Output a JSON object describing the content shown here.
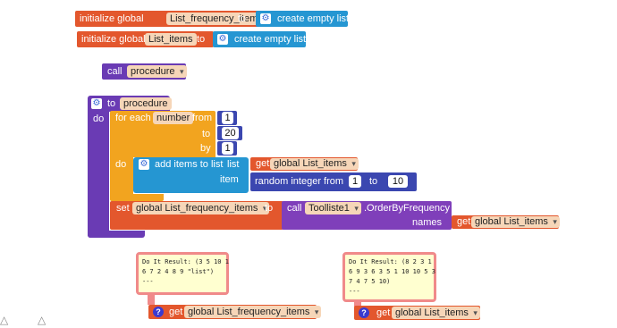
{
  "init1": {
    "label": "initialize global",
    "var": "List_frequency_items",
    "to": "to",
    "value": "create empty list"
  },
  "init2": {
    "label": "initialize global",
    "var": "List_items",
    "to": "to",
    "value": "create empty list"
  },
  "call1": {
    "label": "call",
    "proc": "procedure"
  },
  "proc": {
    "to": "to",
    "name": "procedure",
    "do": "do",
    "for": {
      "label": "for each",
      "var": "number",
      "from": "from",
      "from_val": "1",
      "to": "to",
      "to_val": "20",
      "by": "by",
      "by_val": "1",
      "do": "do"
    },
    "add": {
      "label": "add items to list",
      "list": "list",
      "get": "get",
      "list_var": "global List_items",
      "item": "item",
      "random": "random integer from",
      "r_from": "1",
      "r_to_label": "to",
      "r_to": "10"
    },
    "set": {
      "label": "set",
      "var": "global List_frequency_items",
      "to": "to",
      "call": "call",
      "comp": "Toolliste1",
      "method": ".OrderByFrequency",
      "names": "names",
      "get": "get",
      "names_var": "global List_items"
    }
  },
  "result1": {
    "text": "Do It Result: (3 5 10 1\n6 7 2 4 8 9 \"list\")\n---",
    "get": "get",
    "var": "global List_frequency_items"
  },
  "result2": {
    "text": "Do It Result: (8 2 3 1\n6 9 3 6 3 5 1 10 10 5 3\n7 4 7 5 10)\n---",
    "get": "get",
    "var": "global List_items"
  },
  "icons": {
    "gear": "⚙",
    "question": "?",
    "warning": "△"
  },
  "colors": {
    "variable": "#e3572d",
    "procedure": "#6a3bb4",
    "control": "#f2a41f",
    "list": "#2596d2",
    "math": "#3b47b0",
    "component": "#7f3fba"
  }
}
